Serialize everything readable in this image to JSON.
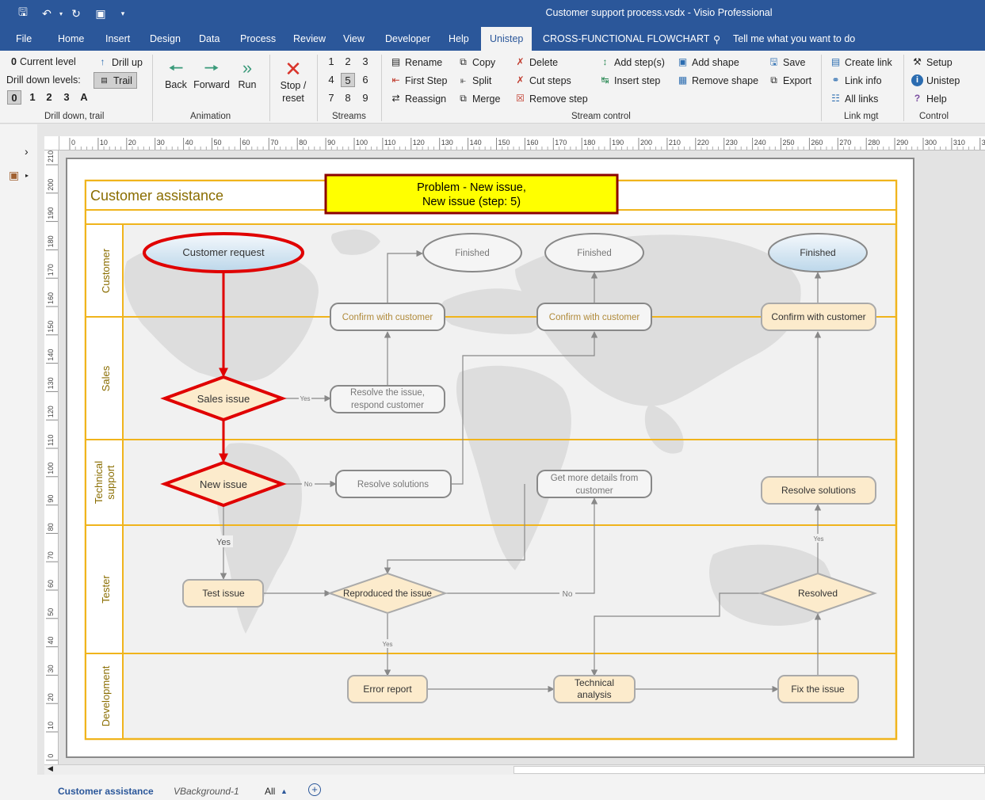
{
  "titlebar": {
    "title": "Customer support process.vsdx  -  Visio Professional",
    "background": "#2b579a"
  },
  "tabs": [
    "File",
    "Home",
    "Insert",
    "Design",
    "Data",
    "Process",
    "Review",
    "View",
    "Developer",
    "Help",
    "Unistep",
    "CROSS-FUNCTIONAL FLOWCHART"
  ],
  "active_tab": "Unistep",
  "tell_me": "Tell me what you want to do",
  "ribbon": {
    "drill": {
      "current_level": "Current level",
      "current_level_value": "0",
      "drill_up": "Drill up",
      "drill_down_levels": "Drill down levels:",
      "trail": "Trail",
      "levels": [
        "0",
        "1",
        "2",
        "3",
        "A"
      ],
      "group": "Drill down, trail"
    },
    "animation": {
      "back": "Back",
      "forward": "Forward",
      "run": "Run",
      "group": "Animation"
    },
    "stop": {
      "line1": "Stop /",
      "line2": "reset"
    },
    "streams": {
      "numbers": [
        "1",
        "2",
        "3",
        "4",
        "5",
        "6",
        "7",
        "8",
        "9"
      ],
      "selected": "5",
      "group": "Streams"
    },
    "stream_control": {
      "rename": "Rename",
      "first_step": "First Step",
      "reassign": "Reassign",
      "copy": "Copy",
      "split": "Split",
      "merge": "Merge",
      "delete": "Delete",
      "cut_steps": "Cut steps",
      "remove_step": "Remove step",
      "add_steps": "Add step(s)",
      "insert_step": "Insert step",
      "add_shape": "Add shape",
      "remove_shape": "Remove shape",
      "save": "Save",
      "export": "Export",
      "group": "Stream control"
    },
    "link_mgt": {
      "create_link": "Create link",
      "link_info": "Link info",
      "all_links": "All links",
      "group": "Link mgt"
    },
    "control": {
      "setup": "Setup",
      "unistep": "Unistep",
      "help": "Help",
      "group": "Control"
    }
  },
  "ruler": {
    "h_ticks": [
      "0",
      "10",
      "20",
      "30",
      "40",
      "50",
      "60",
      "70",
      "80",
      "90",
      "100",
      "110",
      "120",
      "130",
      "140",
      "150",
      "160",
      "170",
      "180",
      "190",
      "200",
      "210",
      "220",
      "230",
      "240",
      "250",
      "260",
      "270",
      "280",
      "290",
      "300",
      "310",
      "3"
    ],
    "v_ticks": [
      "210",
      "200",
      "190",
      "180",
      "170",
      "160",
      "150",
      "140",
      "130",
      "120",
      "110",
      "100",
      "90",
      "80",
      "70",
      "60",
      "50",
      "40",
      "30",
      "20",
      "10",
      "0"
    ]
  },
  "diagram": {
    "title": "Customer assistance",
    "banner_line1": "Problem - New issue,",
    "banner_line2": "New issue (step: 5)",
    "lanes": [
      "Customer",
      "Sales",
      "Technical support",
      "Tester",
      "Development"
    ],
    "shapes": {
      "customer_request": "Customer request",
      "finished_1": "Finished",
      "finished_2": "Finished",
      "finished_3": "Finished",
      "confirm_1": "Confirm with customer",
      "confirm_2": "Confirm with customer",
      "confirm_3": "Confirm with customer",
      "sales_issue": "Sales issue",
      "resolve_issue_1": "Resolve the issue,",
      "resolve_issue_2": "respond customer",
      "new_issue": "New issue",
      "resolve_solutions_1": "Resolve solutions",
      "get_details_1": "Get more details from",
      "get_details_2": "customer",
      "resolve_solutions_2": "Resolve solutions",
      "test_issue": "Test issue",
      "reproduced": "Reproduced the issue",
      "resolved": "Resolved",
      "error_report": "Error report",
      "tech_analysis_1": "Technical",
      "tech_analysis_2": "analysis",
      "fix_issue": "Fix the issue"
    },
    "labels": {
      "yes": "Yes",
      "no": "No"
    },
    "colors": {
      "lane_border": "#f0b41c",
      "highlight": "#e00000",
      "banner_fill": "#ffff00",
      "banner_border": "#8b0000",
      "shape_fill": "#fcebcc",
      "title_color": "#8a6d00"
    }
  },
  "status": {
    "page_tabs": [
      "Customer assistance",
      "VBackground-1",
      "All"
    ]
  }
}
